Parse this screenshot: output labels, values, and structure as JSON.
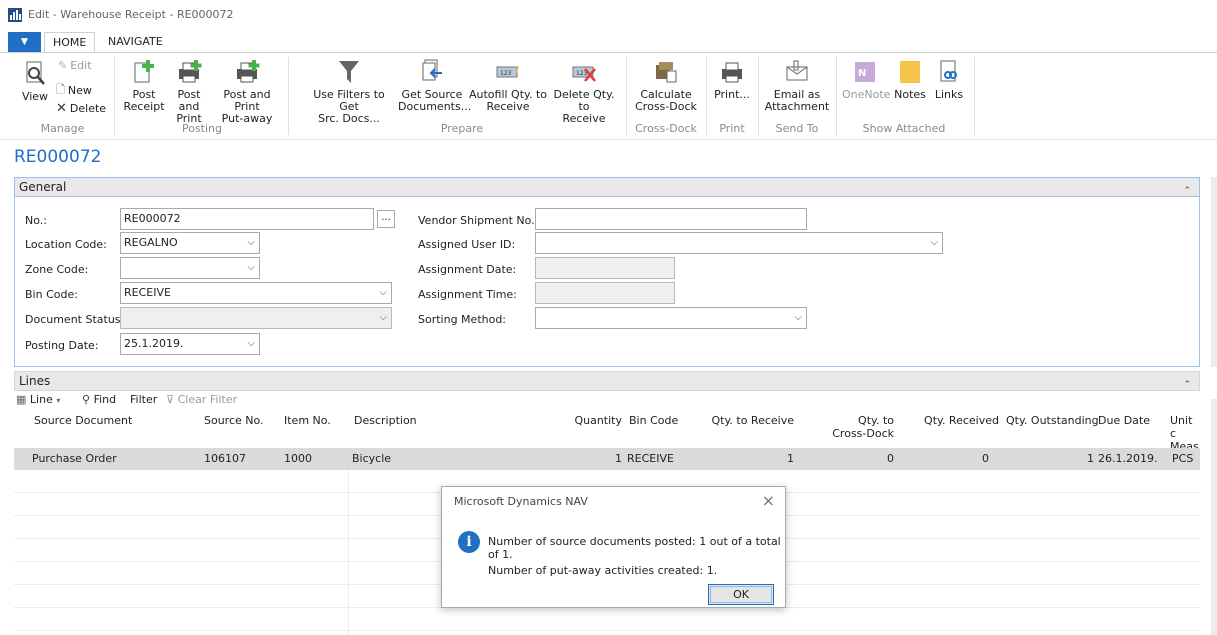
{
  "window": {
    "title": "Edit - Warehouse Receipt - RE000072"
  },
  "ribbon_tabs": [
    "HOME",
    "NAVIGATE"
  ],
  "ribbon": {
    "manage": {
      "label": "Manage",
      "view": "View",
      "edit": "Edit",
      "new": "New",
      "delete": "Delete"
    },
    "posting": {
      "label": "Posting",
      "post_receipt": [
        "Post",
        "Receipt"
      ],
      "post_and_print": [
        "Post and",
        "Print"
      ],
      "post_print_putaway": [
        "Post and Print",
        "Put-away"
      ]
    },
    "prepare": {
      "label": "Prepare",
      "use_filters": [
        "Use Filters to Get",
        "Src. Docs..."
      ],
      "get_source": [
        "Get Source",
        "Documents..."
      ],
      "autofill": [
        "Autofill Qty. to",
        "Receive"
      ],
      "delete_qty": [
        "Delete Qty. to",
        "Receive"
      ]
    },
    "cross_dock": {
      "label": "Cross-Dock",
      "calculate": [
        "Calculate",
        "Cross-Dock"
      ]
    },
    "print": {
      "label": "Print",
      "print": "Print..."
    },
    "send_to": {
      "label": "Send To",
      "email": [
        "Email as",
        "Attachment"
      ]
    },
    "show_attached": {
      "label": "Show Attached",
      "onenote": "OneNote",
      "notes": "Notes",
      "links": "Links"
    }
  },
  "page_title": "RE000072",
  "general": {
    "header": "General",
    "fields": {
      "no": {
        "label": "No.:",
        "value": "RE000072"
      },
      "location_code": {
        "label": "Location Code:",
        "value": "REGALNO"
      },
      "zone_code": {
        "label": "Zone Code:",
        "value": ""
      },
      "bin_code": {
        "label": "Bin Code:",
        "value": "RECEIVE"
      },
      "document_status": {
        "label": "Document Status:",
        "value": ""
      },
      "posting_date": {
        "label": "Posting Date:",
        "value": "25.1.2019."
      },
      "vendor_shipment_no": {
        "label": "Vendor Shipment No.:",
        "value": ""
      },
      "assigned_user_id": {
        "label": "Assigned User ID:",
        "value": ""
      },
      "assignment_date": {
        "label": "Assignment Date:",
        "value": ""
      },
      "assignment_time": {
        "label": "Assignment Time:",
        "value": ""
      },
      "sorting_method": {
        "label": "Sorting Method:",
        "value": ""
      }
    }
  },
  "lines": {
    "header": "Lines",
    "toolbar": {
      "line": "Line",
      "find": "Find",
      "filter": "Filter",
      "clear_filter": "Clear Filter"
    },
    "columns": {
      "source_document": "Source Document",
      "source_no": "Source No.",
      "item_no": "Item No.",
      "description": "Description",
      "quantity": "Quantity",
      "bin_code": "Bin Code",
      "qty_to_receive": "Qty. to Receive",
      "qty_to_cross_dock": [
        "Qty. to",
        "Cross-Dock"
      ],
      "qty_received": "Qty. Received",
      "qty_outstanding": "Qty. Outstanding",
      "due_date": "Due Date",
      "unit_of_measure": [
        "Unit c",
        "Meas"
      ]
    },
    "rows": [
      {
        "source_document": "Purchase Order",
        "source_no": "106107",
        "item_no": "1000",
        "description": "Bicycle",
        "quantity": "1",
        "bin_code": "RECEIVE",
        "qty_to_receive": "1",
        "qty_to_cross_dock": "0",
        "qty_received": "0",
        "qty_outstanding": "1",
        "due_date": "26.1.2019.",
        "unit_of_measure": "PCS"
      }
    ]
  },
  "dialog": {
    "title": "Microsoft Dynamics NAV",
    "message1": "Number of source documents posted: 1 out of a total of 1.",
    "message2": "Number of put-away activities created: 1.",
    "ok": "OK"
  },
  "colors": {
    "accent": "#1f6fc5",
    "selected_row": "#dadada"
  }
}
